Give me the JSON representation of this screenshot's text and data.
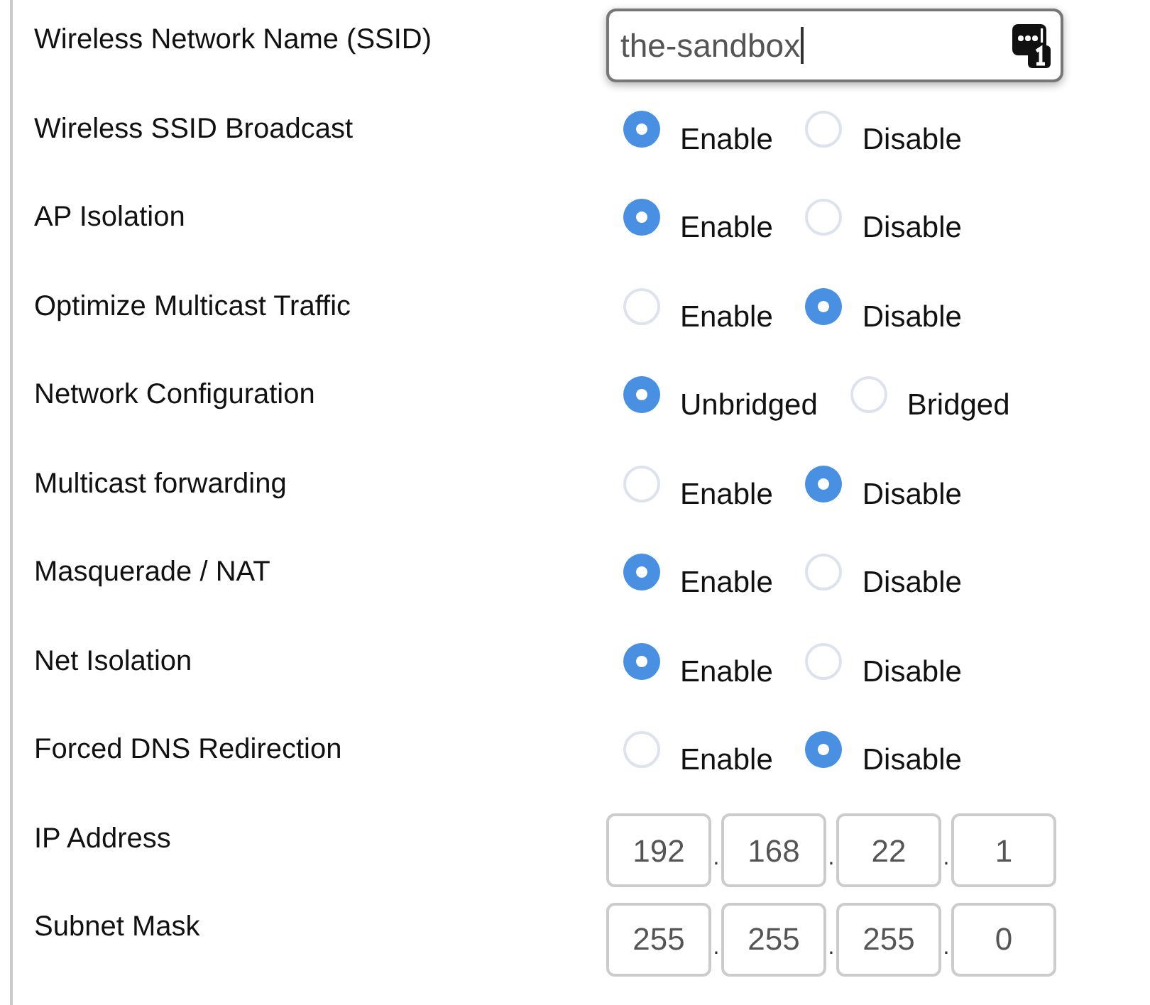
{
  "rows": [
    {
      "kind": "text",
      "label": "Wireless Network Name (SSID)",
      "value": "the-sandbox"
    },
    {
      "kind": "radio",
      "label": "Wireless SSID Broadcast",
      "options": [
        {
          "label": "Enable",
          "selected": true
        },
        {
          "label": "Disable",
          "selected": false
        }
      ]
    },
    {
      "kind": "radio",
      "label": "AP Isolation",
      "options": [
        {
          "label": "Enable",
          "selected": true
        },
        {
          "label": "Disable",
          "selected": false
        }
      ]
    },
    {
      "kind": "radio",
      "label": "Optimize Multicast Traffic",
      "options": [
        {
          "label": "Enable",
          "selected": false
        },
        {
          "label": "Disable",
          "selected": true
        }
      ]
    },
    {
      "kind": "radio",
      "label": "Network Configuration",
      "options": [
        {
          "label": "Unbridged",
          "selected": true
        },
        {
          "label": "Bridged",
          "selected": false
        }
      ]
    },
    {
      "kind": "radio",
      "label": "Multicast forwarding",
      "options": [
        {
          "label": "Enable",
          "selected": false
        },
        {
          "label": "Disable",
          "selected": true
        }
      ]
    },
    {
      "kind": "radio",
      "label": "Masquerade / NAT",
      "options": [
        {
          "label": "Enable",
          "selected": true
        },
        {
          "label": "Disable",
          "selected": false
        }
      ]
    },
    {
      "kind": "radio",
      "label": "Net Isolation",
      "options": [
        {
          "label": "Enable",
          "selected": true
        },
        {
          "label": "Disable",
          "selected": false
        }
      ]
    },
    {
      "kind": "radio",
      "label": "Forced DNS Redirection",
      "options": [
        {
          "label": "Enable",
          "selected": false
        },
        {
          "label": "Disable",
          "selected": true
        }
      ]
    },
    {
      "kind": "ip",
      "label": "IP Address",
      "octets": [
        "192",
        "168",
        "22",
        "1"
      ],
      "separators": [
        ".",
        ".",
        "."
      ]
    },
    {
      "kind": "ip",
      "label": "Subnet Mask",
      "octets": [
        "255",
        "255",
        "255",
        "0"
      ],
      "separators": [
        ".",
        ".",
        "."
      ]
    }
  ]
}
